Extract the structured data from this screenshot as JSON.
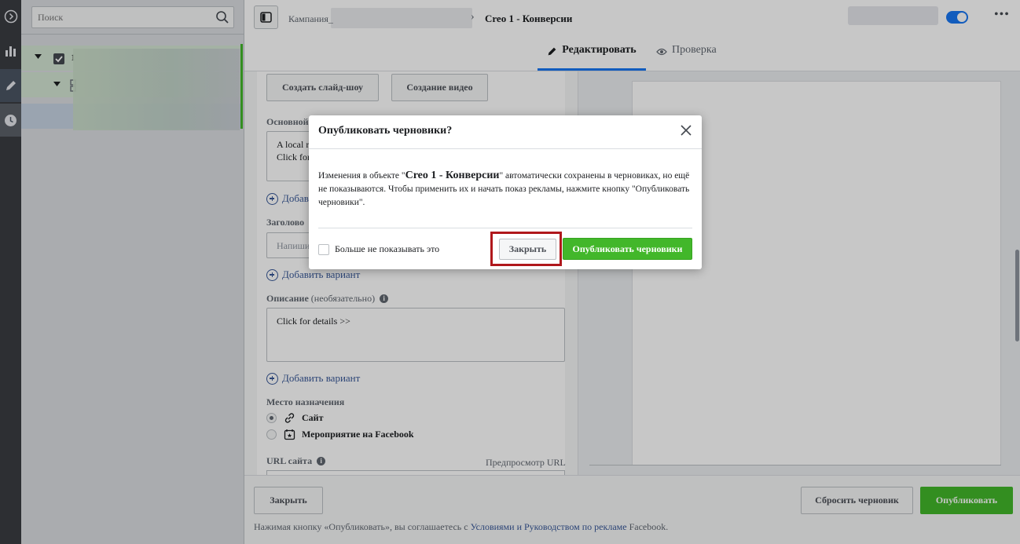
{
  "search": {
    "placeholder": "Поиск"
  },
  "tree": {
    "row1_partial": "1"
  },
  "breadcrumb": {
    "campaign": "Кампания_",
    "current": "Creo 1 - Конверсии"
  },
  "tabs": {
    "edit": "Редактировать",
    "review": "Проверка"
  },
  "form": {
    "btn_slideshow": "Создать слайд-шоу",
    "btn_video": "Создание видео",
    "primary_text_label": "Основной",
    "primary_text_line1": "A local r",
    "primary_text_line2": "Click for",
    "add_variant_1": "Добавь",
    "headline_label": "Заголово",
    "headline_placeholder": "Напиши",
    "add_variant_2": "Добавить вариант",
    "description_label": "Описание",
    "description_optional": "(необязательно)",
    "description_value": "Click for details >>",
    "add_variant_3": "Добавить вариант",
    "destination_label": "Место назначения",
    "destination_options": [
      {
        "label": "Сайт",
        "selected": true,
        "icon": "link-icon"
      },
      {
        "label": "Мероприятие на Facebook",
        "selected": false,
        "icon": "event-icon"
      }
    ],
    "url_label": "URL сайта",
    "url_preview": "Предпросмотр URL"
  },
  "footer": {
    "close": "Закрыть",
    "reset_draft": "Сбросить черновик",
    "publish": "Опубликовать",
    "legal_prefix": "Нажимая кнопку «Опубликовать», вы соглашаетесь с ",
    "legal_link": "Условиями и Руководством по рекламе",
    "legal_suffix": " Facebook."
  },
  "modal": {
    "title": "Опубликовать черновики?",
    "body_prefix": "Изменения в объекте \"",
    "body_object": "Creo 1 - Конверсии",
    "body_suffix": "\" автоматически сохранены в черновиках, но ещё не показываются. Чтобы применить их и начать показ рекламы, нажмите кнопку \"Опубликовать черновики\".",
    "checkbox_label": "Больше не показывать это",
    "close_btn": "Закрыть",
    "publish_btn": "Опубликовать черновики"
  },
  "colors": {
    "accent_blue": "#1877f2",
    "publish_green": "#42b72a",
    "highlight_red": "#b0181c",
    "link": "#385898"
  }
}
